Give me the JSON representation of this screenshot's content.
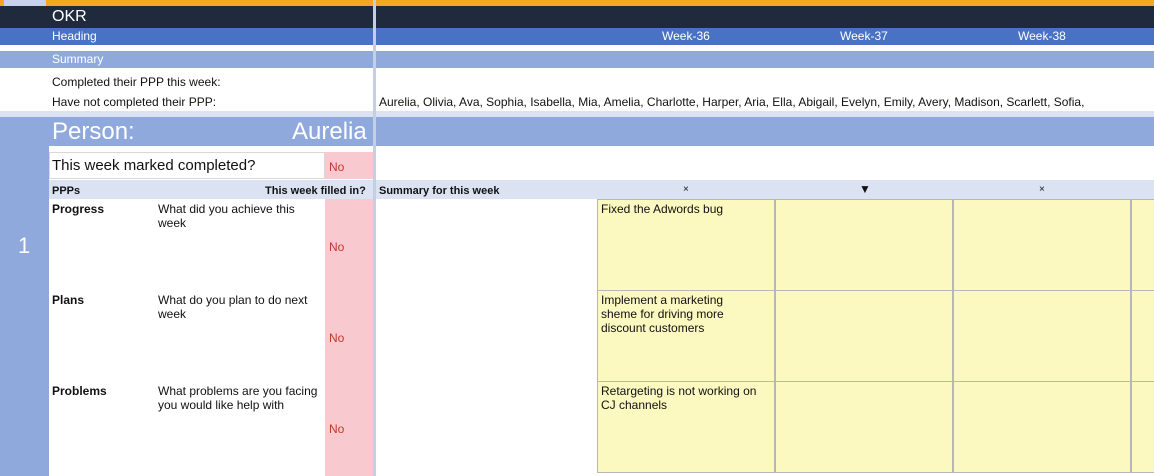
{
  "title": "OKR",
  "heading": "Heading",
  "weeks": [
    "Week-36",
    "Week-37",
    "Week-38"
  ],
  "summary": {
    "label": "Summary",
    "completed_label": "Completed their PPP this week:",
    "not_completed_label": "Have not completed their PPP:",
    "not_completed_names": "Aurelia, Olivia, Ava, Sophia, Isabella, Mia, Amelia, Charlotte, Harper, Aria, Ella, Abigail, Evelyn, Emily, Avery, Madison, Scarlett, Sofia,"
  },
  "person": {
    "index": "1",
    "label": "Person:",
    "name": "Aurelia",
    "marked_completed_label": "This week marked completed?",
    "marked_completed_value": "No"
  },
  "ppp_header": {
    "ppps": "PPPs",
    "filled_in": "This week filled in?",
    "summary_week": "Summary for this week",
    "week_controls": [
      "×",
      "▼",
      "×"
    ]
  },
  "rows": [
    {
      "category": "Progress",
      "question": "What did you achieve this week",
      "filled": "No",
      "week_note": "Fixed the Adwords bug"
    },
    {
      "category": "Plans",
      "question": "What do you plan to do next week",
      "filled": "No",
      "week_note": "Implement a marketing sheme for driving more discount customers"
    },
    {
      "category": "Problems",
      "question": "What problems are you facing you would like help with",
      "filled": "No",
      "week_note": "Retargeting is not working on CJ channels"
    }
  ],
  "colors": {
    "accent_bar": "#f5a623",
    "title_bar": "#1f2a3d",
    "header_blue": "#4a72c4",
    "light_blue": "#8fa9dc",
    "pale_blue": "#dbe3f3",
    "pink": "#f9c9d0",
    "note_yellow": "#fbf8c0"
  }
}
